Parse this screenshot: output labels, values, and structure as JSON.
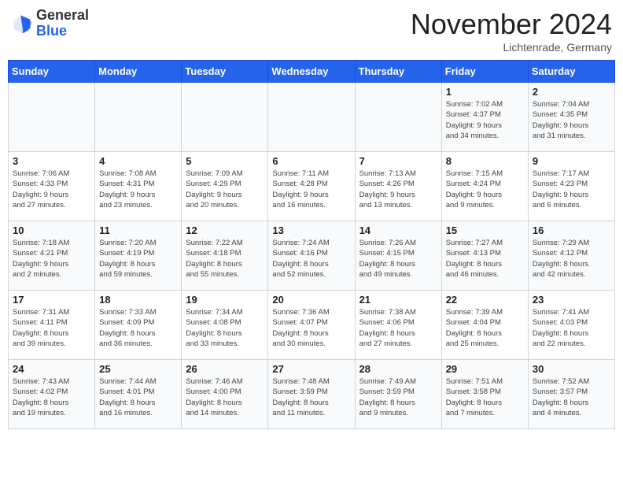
{
  "header": {
    "logo_general": "General",
    "logo_blue": "Blue",
    "month_title": "November 2024",
    "location": "Lichtenrade, Germany"
  },
  "weekdays": [
    "Sunday",
    "Monday",
    "Tuesday",
    "Wednesday",
    "Thursday",
    "Friday",
    "Saturday"
  ],
  "weeks": [
    [
      {
        "day": "",
        "info": ""
      },
      {
        "day": "",
        "info": ""
      },
      {
        "day": "",
        "info": ""
      },
      {
        "day": "",
        "info": ""
      },
      {
        "day": "",
        "info": ""
      },
      {
        "day": "1",
        "info": "Sunrise: 7:02 AM\nSunset: 4:37 PM\nDaylight: 9 hours\nand 34 minutes."
      },
      {
        "day": "2",
        "info": "Sunrise: 7:04 AM\nSunset: 4:35 PM\nDaylight: 9 hours\nand 31 minutes."
      }
    ],
    [
      {
        "day": "3",
        "info": "Sunrise: 7:06 AM\nSunset: 4:33 PM\nDaylight: 9 hours\nand 27 minutes."
      },
      {
        "day": "4",
        "info": "Sunrise: 7:08 AM\nSunset: 4:31 PM\nDaylight: 9 hours\nand 23 minutes."
      },
      {
        "day": "5",
        "info": "Sunrise: 7:09 AM\nSunset: 4:29 PM\nDaylight: 9 hours\nand 20 minutes."
      },
      {
        "day": "6",
        "info": "Sunrise: 7:11 AM\nSunset: 4:28 PM\nDaylight: 9 hours\nand 16 minutes."
      },
      {
        "day": "7",
        "info": "Sunrise: 7:13 AM\nSunset: 4:26 PM\nDaylight: 9 hours\nand 13 minutes."
      },
      {
        "day": "8",
        "info": "Sunrise: 7:15 AM\nSunset: 4:24 PM\nDaylight: 9 hours\nand 9 minutes."
      },
      {
        "day": "9",
        "info": "Sunrise: 7:17 AM\nSunset: 4:23 PM\nDaylight: 9 hours\nand 6 minutes."
      }
    ],
    [
      {
        "day": "10",
        "info": "Sunrise: 7:18 AM\nSunset: 4:21 PM\nDaylight: 9 hours\nand 2 minutes."
      },
      {
        "day": "11",
        "info": "Sunrise: 7:20 AM\nSunset: 4:19 PM\nDaylight: 8 hours\nand 59 minutes."
      },
      {
        "day": "12",
        "info": "Sunrise: 7:22 AM\nSunset: 4:18 PM\nDaylight: 8 hours\nand 55 minutes."
      },
      {
        "day": "13",
        "info": "Sunrise: 7:24 AM\nSunset: 4:16 PM\nDaylight: 8 hours\nand 52 minutes."
      },
      {
        "day": "14",
        "info": "Sunrise: 7:26 AM\nSunset: 4:15 PM\nDaylight: 8 hours\nand 49 minutes."
      },
      {
        "day": "15",
        "info": "Sunrise: 7:27 AM\nSunset: 4:13 PM\nDaylight: 8 hours\nand 46 minutes."
      },
      {
        "day": "16",
        "info": "Sunrise: 7:29 AM\nSunset: 4:12 PM\nDaylight: 8 hours\nand 42 minutes."
      }
    ],
    [
      {
        "day": "17",
        "info": "Sunrise: 7:31 AM\nSunset: 4:11 PM\nDaylight: 8 hours\nand 39 minutes."
      },
      {
        "day": "18",
        "info": "Sunrise: 7:33 AM\nSunset: 4:09 PM\nDaylight: 8 hours\nand 36 minutes."
      },
      {
        "day": "19",
        "info": "Sunrise: 7:34 AM\nSunset: 4:08 PM\nDaylight: 8 hours\nand 33 minutes."
      },
      {
        "day": "20",
        "info": "Sunrise: 7:36 AM\nSunset: 4:07 PM\nDaylight: 8 hours\nand 30 minutes."
      },
      {
        "day": "21",
        "info": "Sunrise: 7:38 AM\nSunset: 4:06 PM\nDaylight: 8 hours\nand 27 minutes."
      },
      {
        "day": "22",
        "info": "Sunrise: 7:39 AM\nSunset: 4:04 PM\nDaylight: 8 hours\nand 25 minutes."
      },
      {
        "day": "23",
        "info": "Sunrise: 7:41 AM\nSunset: 4:03 PM\nDaylight: 8 hours\nand 22 minutes."
      }
    ],
    [
      {
        "day": "24",
        "info": "Sunrise: 7:43 AM\nSunset: 4:02 PM\nDaylight: 8 hours\nand 19 minutes."
      },
      {
        "day": "25",
        "info": "Sunrise: 7:44 AM\nSunset: 4:01 PM\nDaylight: 8 hours\nand 16 minutes."
      },
      {
        "day": "26",
        "info": "Sunrise: 7:46 AM\nSunset: 4:00 PM\nDaylight: 8 hours\nand 14 minutes."
      },
      {
        "day": "27",
        "info": "Sunrise: 7:48 AM\nSunset: 3:59 PM\nDaylight: 8 hours\nand 11 minutes."
      },
      {
        "day": "28",
        "info": "Sunrise: 7:49 AM\nSunset: 3:59 PM\nDaylight: 8 hours\nand 9 minutes."
      },
      {
        "day": "29",
        "info": "Sunrise: 7:51 AM\nSunset: 3:58 PM\nDaylight: 8 hours\nand 7 minutes."
      },
      {
        "day": "30",
        "info": "Sunrise: 7:52 AM\nSunset: 3:57 PM\nDaylight: 8 hours\nand 4 minutes."
      }
    ]
  ]
}
